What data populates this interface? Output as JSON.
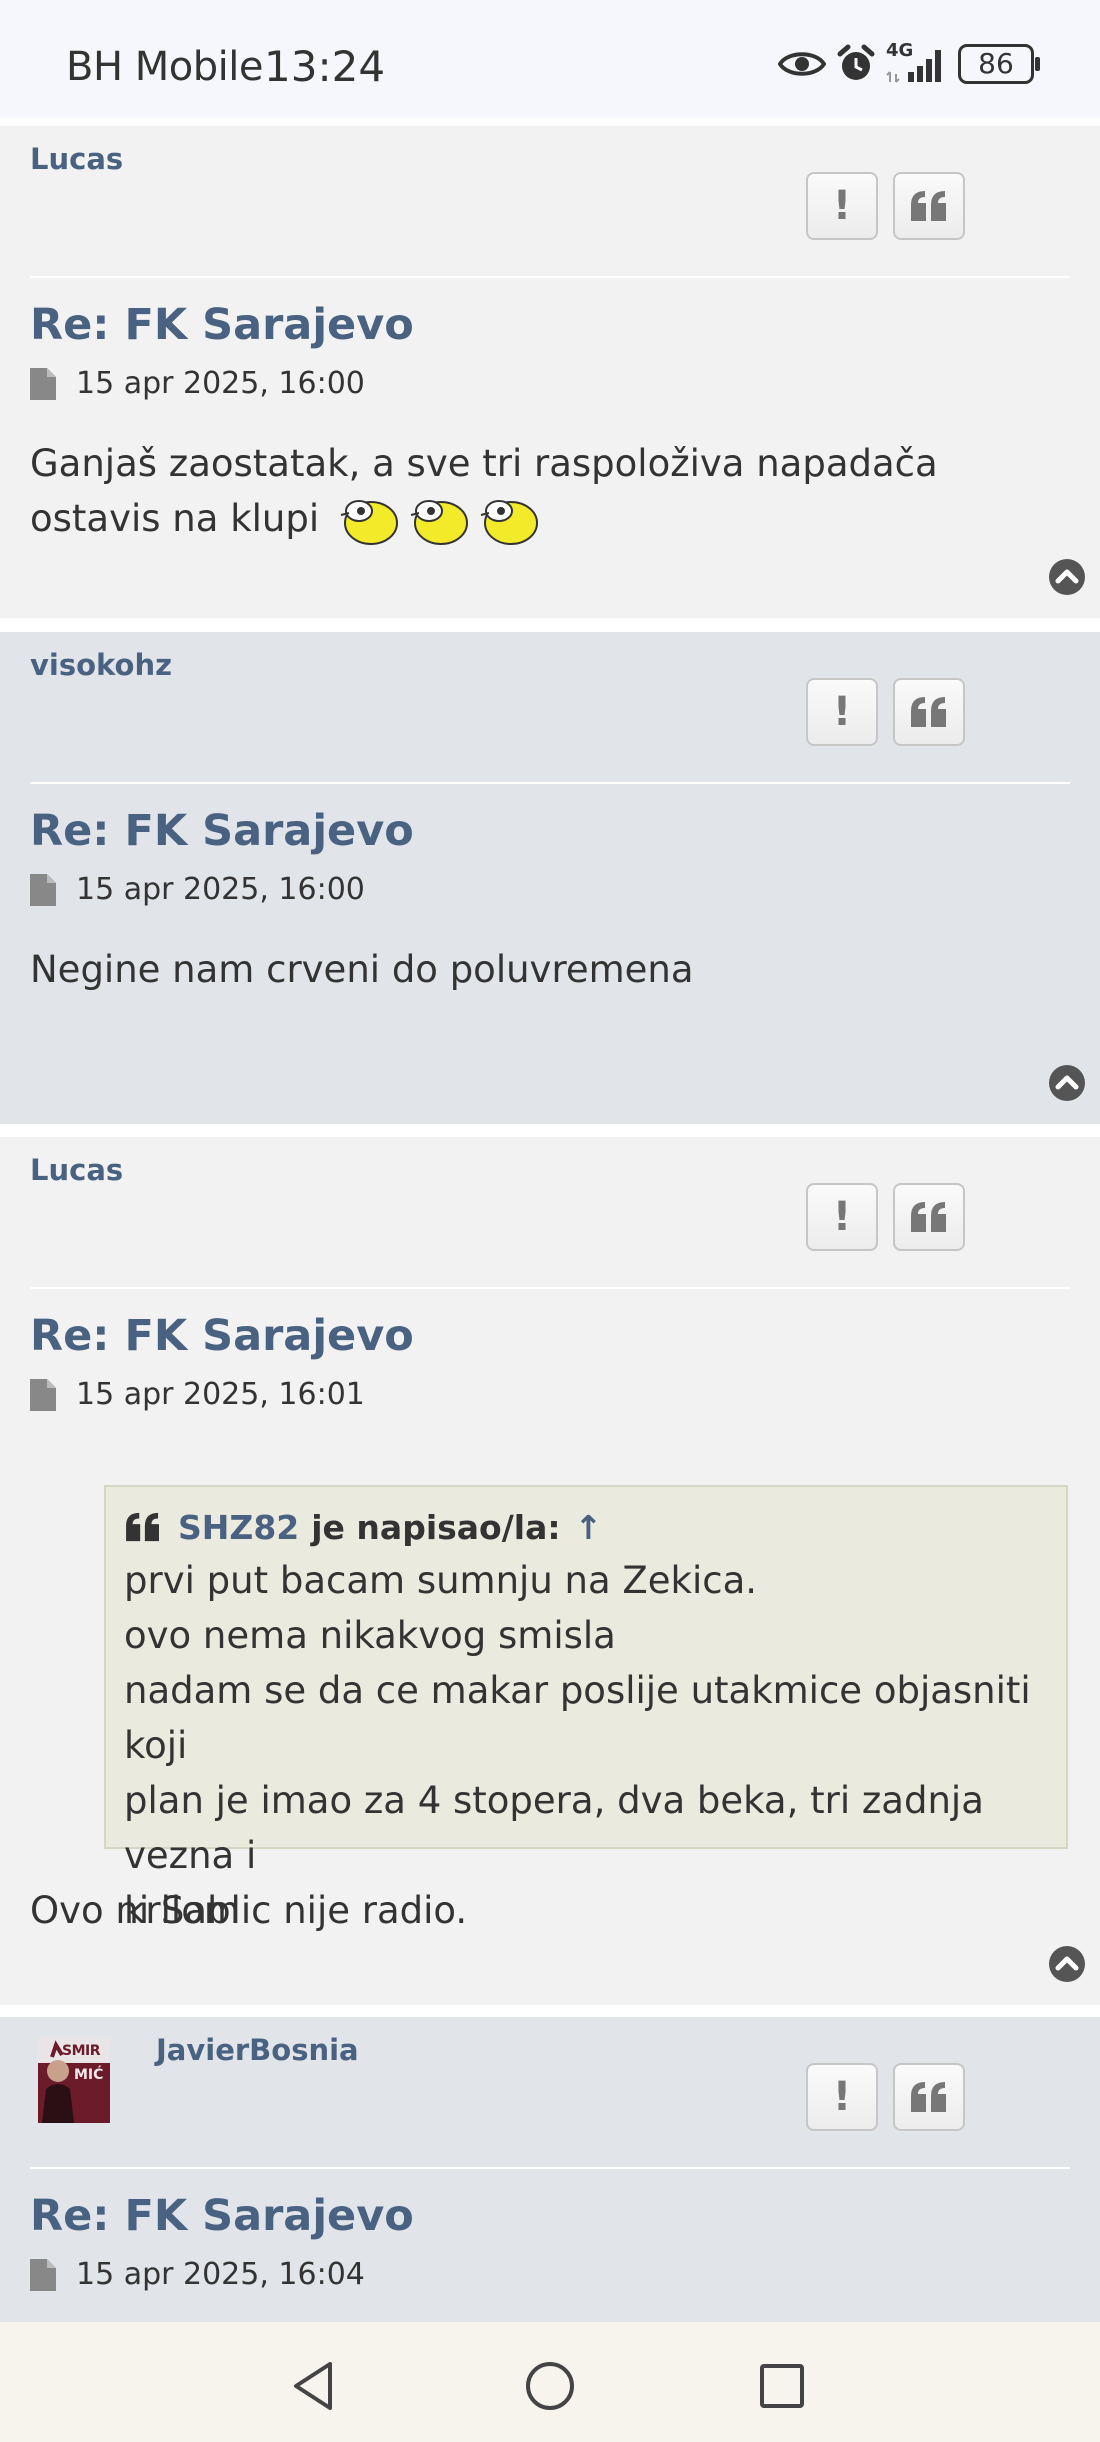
{
  "status_bar": {
    "carrier": "BH Mobile",
    "time": "13:24",
    "network": "4G",
    "battery": "86"
  },
  "posts": [
    {
      "author": "Lucas",
      "title": "Re: FK Sarajevo",
      "date": "15 apr 2025, 16:00",
      "content": "Ganjaš zaostatak, a sve tri raspoloživa napadača ostavis na klupi",
      "smileys": 3
    },
    {
      "author": "visokohz",
      "title": "Re: FK Sarajevo",
      "date": "15 apr 2025, 16:00",
      "content": "Negine nam crveni do poluvremena"
    },
    {
      "author": "Lucas",
      "title": "Re: FK Sarajevo",
      "date": "15 apr 2025, 16:01",
      "quote": {
        "author": "SHZ82",
        "wrote": "je napisao/la:",
        "arrow": "↑",
        "lines": [
          "prvi put bacam sumnju na Zekica.",
          "ovo nema nikakvog smisla",
          "nadam se da ce makar poslije utakmice objasniti koji",
          "plan je imao za 4 stopera, dva beka, tri zadnja vezna i",
          "krilom"
        ]
      },
      "content": "Ovo ni Sablic nije radio."
    },
    {
      "author": "JavierBosnia",
      "avatar_text": [
        "SMIR",
        "MIĆ"
      ],
      "title": "Re: FK Sarajevo",
      "date": "15 apr 2025, 16:04"
    }
  ],
  "buttons": {
    "report": "!"
  },
  "colors": {
    "accent": "#4a6281",
    "post_bg_light": "#f2f2f2",
    "post_bg_dark": "#e1e4e8",
    "quote_bg": "#ebeadf"
  },
  "icons": [
    "eye-icon",
    "alarm-icon",
    "signal-icon",
    "battery-icon",
    "report-icon",
    "quote-icon",
    "document-icon",
    "back-to-top-icon",
    "nav-back-icon",
    "nav-home-icon",
    "nav-recents-icon"
  ]
}
